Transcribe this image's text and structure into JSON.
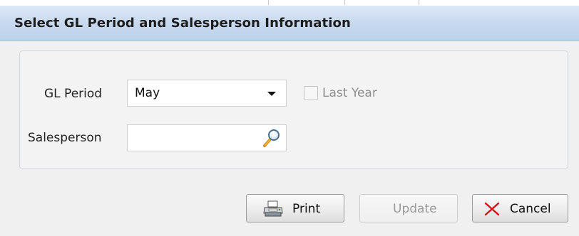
{
  "dialog": {
    "title": "Select GL Period and Salesperson Information"
  },
  "form": {
    "gl_period_label": "GL Period",
    "gl_period_value": "May",
    "last_year_label": "Last Year",
    "last_year_checked": false,
    "salesperson_label": "Salesperson",
    "salesperson_value": ""
  },
  "buttons": {
    "print": "Print",
    "update": "Update",
    "cancel": "Cancel"
  },
  "icons": {
    "dropdown": "chevron-down-icon",
    "search": "magnifier-icon",
    "print": "printer-icon",
    "cancel": "close-icon"
  },
  "colors": {
    "titlebar": "#c6d8ee",
    "cancel_x": "#d0161b"
  }
}
